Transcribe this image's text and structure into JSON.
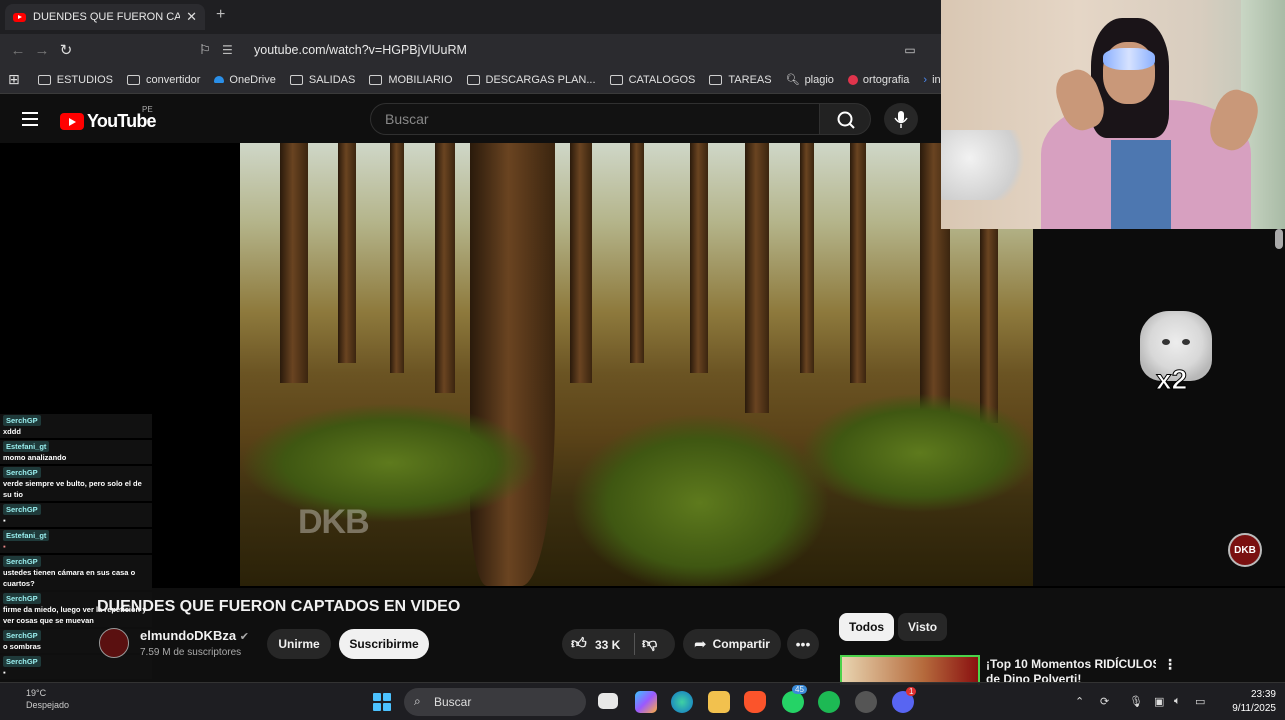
{
  "browser": {
    "tab_title": "DUENDES QUE FUERON CAPTAD",
    "url": "youtube.com/watch?v=HGPBjVlUuRM",
    "bookmarks": [
      "ESTUDIOS",
      "convertidor",
      "OneDrive",
      "SALIDAS",
      "MOBILIARIO",
      "DESCARGAS PLAN...",
      "CATALOGOS",
      "TAREAS",
      "plagio",
      "ortografia",
      "ingles esp"
    ]
  },
  "youtube": {
    "logo_text": "YouTube",
    "region": "PE",
    "search_placeholder": "Buscar"
  },
  "video": {
    "watermark": "DKB",
    "overlay_text": "x2",
    "corner_badge": "DKB",
    "title": "DUENDES QUE FUERON CAPTADOS EN VIDEO",
    "channel": "elmundoDKBza",
    "subscribers": "7.59 M de suscriptores",
    "join_label": "Unirme",
    "subscribe_label": "Suscribirme",
    "likes": "33 K",
    "share_label": "Compartir"
  },
  "chips": [
    "Todos",
    "Visto"
  ],
  "recommendation": {
    "title_line1": "¡Top 10 Momentos RIDÍCULOS",
    "title_line2": "de Dino Polverti!"
  },
  "chat": [
    {
      "user": "SerchGP",
      "text": "xddd"
    },
    {
      "user": "Estefani_gt",
      "text": "momo analizando"
    },
    {
      "user": "SerchGP",
      "text": "verde siempre ve bulto, pero solo el de su tio"
    },
    {
      "user": "SerchGP",
      "text": ""
    },
    {
      "user": "Estefani_gt",
      "text": ""
    },
    {
      "user": "SerchGP",
      "text": "ustedes tienen cámara en sus casa o cuartos?"
    },
    {
      "user": "SerchGP",
      "text": "firme da miedo, luego ver la repeticion y ver cosas que se muevan"
    },
    {
      "user": "SerchGP",
      "text": "o sombras"
    },
    {
      "user": "SerchGP",
      "text": ""
    }
  ],
  "taskbar": {
    "search_label": "Buscar",
    "weather_temp": "19°C",
    "weather_desc": "Despejado",
    "time": "23:39",
    "date": "9/11/2025",
    "whatsapp_badge": "45",
    "discord_badge": "1"
  },
  "colors": {
    "youtube_red": "#ff0000",
    "accent_green": "#4bd24b"
  }
}
